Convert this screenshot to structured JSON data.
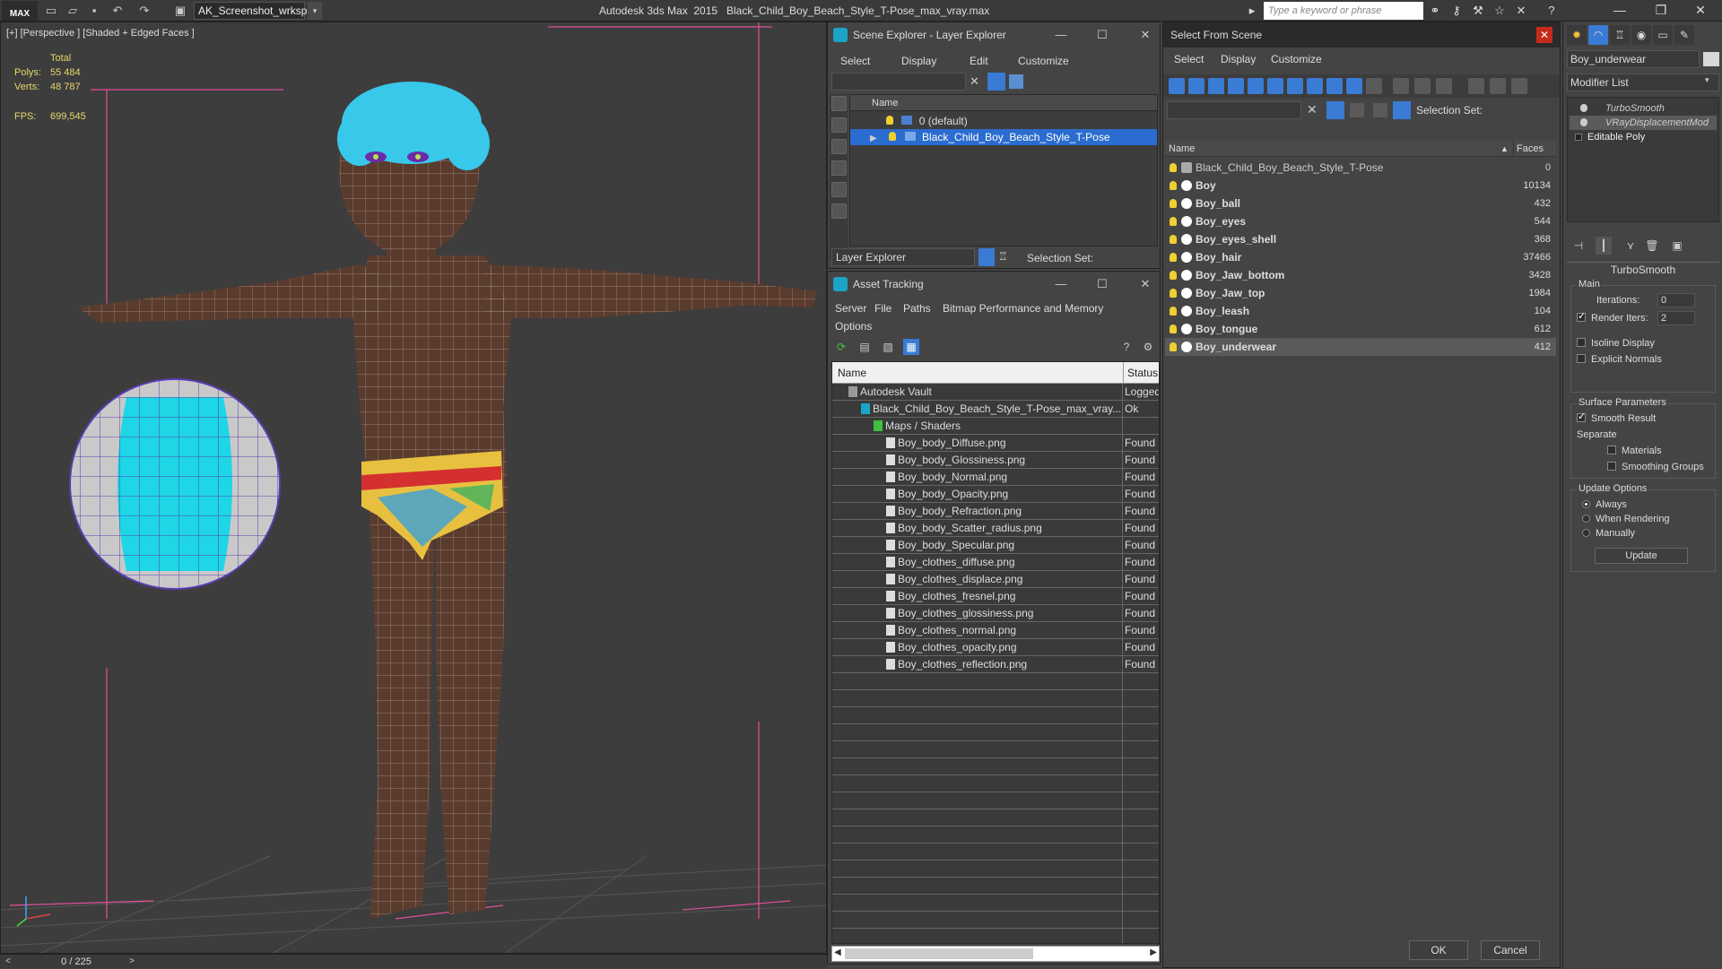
{
  "app": {
    "logo_text": "MAX",
    "workspace": "AK_Screenshot_wrksp",
    "title": "Autodesk 3ds Max  2015",
    "file": "Black_Child_Boy_Beach_Style_T-Pose_max_vray.max",
    "search_placeholder": "Type a keyword or phrase"
  },
  "viewport": {
    "label": "[+] [Perspective ] [Shaded + Edged Faces ]",
    "stats_header": "Total",
    "polys_label": "Polys:",
    "polys": "55 484",
    "verts_label": "Verts:",
    "verts": "48 787",
    "fps_label": "FPS:",
    "fps": "699,545"
  },
  "timeline": {
    "frame": "0 / 225"
  },
  "scene_explorer": {
    "title": "Scene Explorer - Layer Explorer",
    "menu": [
      "Select",
      "Display",
      "Edit",
      "Customize"
    ],
    "column": "Name",
    "layers": [
      "0 (default)",
      "Black_Child_Boy_Beach_Style_T-Pose"
    ],
    "layer_dropdown": "Layer Explorer",
    "selection_set_label": "Selection Set:"
  },
  "asset_tracking": {
    "title": "Asset Tracking",
    "menu": [
      "Server",
      "File",
      "Paths",
      "Bitmap Performance and Memory",
      "Options"
    ],
    "col_name": "Name",
    "col_status": "Status",
    "rows": [
      {
        "name": "Autodesk Vault",
        "status": "Logged",
        "indent": 0
      },
      {
        "name": "Black_Child_Boy_Beach_Style_T-Pose_max_vray....",
        "status": "Ok",
        "indent": 1
      },
      {
        "name": "Maps / Shaders",
        "status": "",
        "indent": 2
      },
      {
        "name": "Boy_body_Diffuse.png",
        "status": "Found",
        "indent": 3
      },
      {
        "name": "Boy_body_Glossiness.png",
        "status": "Found",
        "indent": 3
      },
      {
        "name": "Boy_body_Normal.png",
        "status": "Found",
        "indent": 3
      },
      {
        "name": "Boy_body_Opacity.png",
        "status": "Found",
        "indent": 3
      },
      {
        "name": "Boy_body_Refraction.png",
        "status": "Found",
        "indent": 3
      },
      {
        "name": "Boy_body_Scatter_radius.png",
        "status": "Found",
        "indent": 3
      },
      {
        "name": "Boy_body_Specular.png",
        "status": "Found",
        "indent": 3
      },
      {
        "name": "Boy_clothes_diffuse.png",
        "status": "Found",
        "indent": 3
      },
      {
        "name": "Boy_clothes_displace.png",
        "status": "Found",
        "indent": 3
      },
      {
        "name": "Boy_clothes_fresnel.png",
        "status": "Found",
        "indent": 3
      },
      {
        "name": "Boy_clothes_glossiness.png",
        "status": "Found",
        "indent": 3
      },
      {
        "name": "Boy_clothes_normal.png",
        "status": "Found",
        "indent": 3
      },
      {
        "name": "Boy_clothes_opacity.png",
        "status": "Found",
        "indent": 3
      },
      {
        "name": "Boy_clothes_reflection.png",
        "status": "Found",
        "indent": 3
      }
    ]
  },
  "select_from_scene": {
    "title": "Select From Scene",
    "menu": [
      "Select",
      "Display",
      "Customize"
    ],
    "selection_set_label": "Selection Set:",
    "col_name": "Name",
    "col_faces": "Faces",
    "objects": [
      {
        "name": "Black_Child_Boy_Beach_Style_T-Pose",
        "faces": "0"
      },
      {
        "name": "Boy",
        "faces": "10134"
      },
      {
        "name": "Boy_ball",
        "faces": "432"
      },
      {
        "name": "Boy_eyes",
        "faces": "544"
      },
      {
        "name": "Boy_eyes_shell",
        "faces": "368"
      },
      {
        "name": "Boy_hair",
        "faces": "37466"
      },
      {
        "name": "Boy_Jaw_bottom",
        "faces": "3428"
      },
      {
        "name": "Boy_Jaw_top",
        "faces": "1984"
      },
      {
        "name": "Boy_leash",
        "faces": "104"
      },
      {
        "name": "Boy_tongue",
        "faces": "612"
      },
      {
        "name": "Boy_underwear",
        "faces": "412"
      }
    ],
    "ok": "OK",
    "cancel": "Cancel"
  },
  "command_panel": {
    "object_name": "Boy_underwear",
    "modifier_list": "Modifier List",
    "stack": [
      "TurboSmooth",
      "VRayDisplacementMod",
      "Editable Poly"
    ],
    "rollout_title": "TurboSmooth",
    "main_label": "Main",
    "iterations_label": "Iterations:",
    "iterations": "0",
    "render_iters_label": "Render Iters:",
    "render_iters": "2",
    "isoline_label": "Isoline Display",
    "explicit_normals_label": "Explicit Normals",
    "surface_params_label": "Surface Parameters",
    "smooth_result_label": "Smooth Result",
    "separate_label": "Separate",
    "materials_label": "Materials",
    "smoothing_groups_label": "Smoothing Groups",
    "update_options_label": "Update Options",
    "always_label": "Always",
    "when_rendering_label": "When Rendering",
    "manually_label": "Manually",
    "update_button": "Update"
  }
}
